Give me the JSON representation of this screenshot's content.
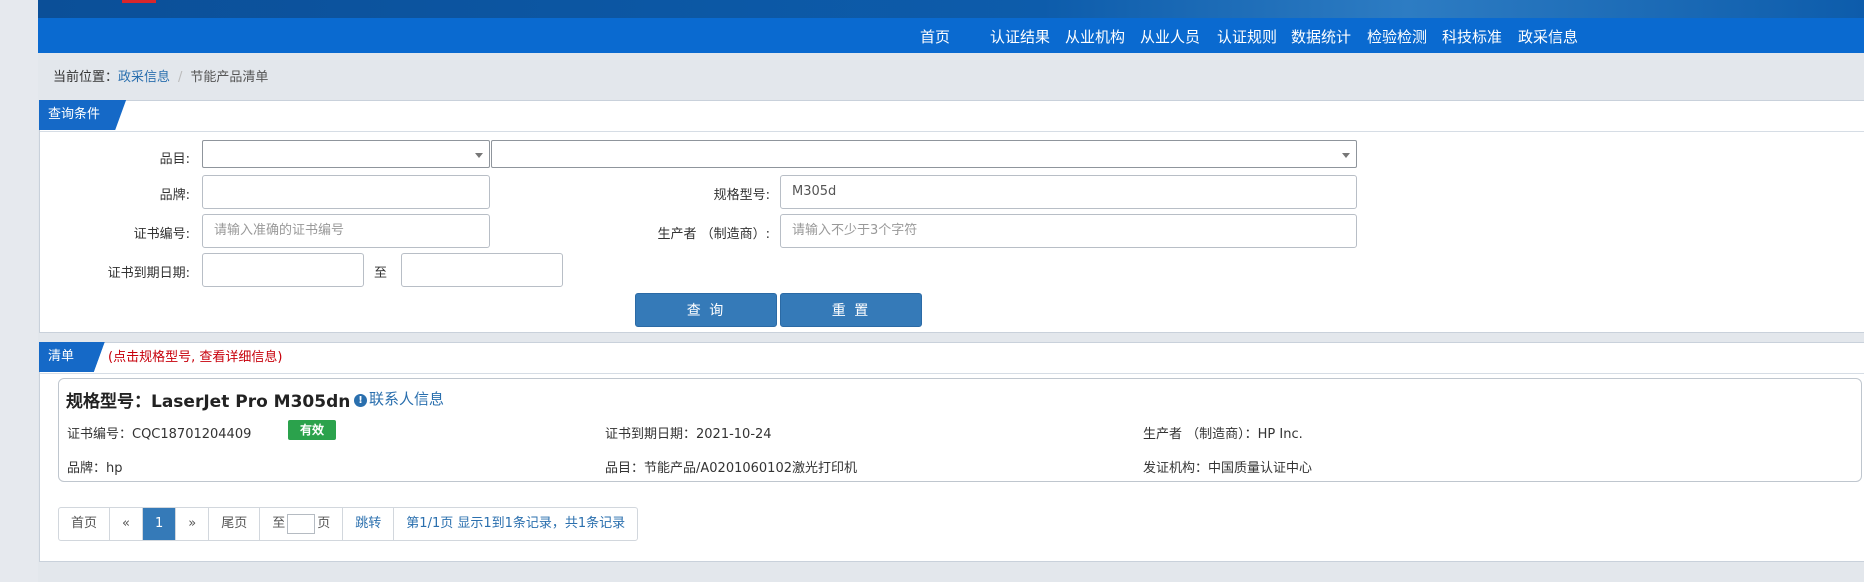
{
  "nav": {
    "items": [
      "首页",
      "认证结果",
      "从业机构",
      "从业人员",
      "认证规则",
      "数据统计",
      "检验检测",
      "科技标准",
      "政采信息"
    ]
  },
  "breadcrumb": {
    "prefix": "当前位置：",
    "parent": "政采信息",
    "current": "节能产品清单"
  },
  "query": {
    "tag": "查询条件",
    "category_label": "品目:",
    "category_value": "",
    "subcategory_value": "",
    "brand_label": "品牌:",
    "brand_value": "",
    "model_label": "规格型号:",
    "model_value": "M305d",
    "cert_no_label": "证书编号:",
    "cert_no_placeholder": "请输入准确的证书编号",
    "producer_label": "生产者 （制造商）:",
    "producer_placeholder": "请输入不少于3个字符",
    "expiry_label": "证书到期日期:",
    "date_to": "至",
    "search_button": "查 询",
    "reset_button": "重 置"
  },
  "list": {
    "tag": "清单",
    "note": "(点击规格型号, 查看详细信息)",
    "record": {
      "title": "规格型号：LaserJet Pro M305dn",
      "contact_link": "联系人信息",
      "cert_no": "证书编号：CQC18701204409",
      "status": "有效",
      "expiry": "证书到期日期：2021-10-24",
      "producer": "生产者 （制造商）：HP Inc.",
      "brand": "品牌：hp",
      "category": "品目：节能产品/A0201060102激光打印机",
      "issuer": "发证机构：中国质量认证中心"
    }
  },
  "pager": {
    "first": "首页",
    "prev": "«",
    "page": "1",
    "next": "»",
    "last": "尾页",
    "goto_prefix": "至",
    "goto_suffix": "页",
    "jump": "跳转",
    "summary": "第1/1页  显示1到1条记录，共1条记录"
  },
  "colors": {
    "nav_blue": "#0a6ad0",
    "button_blue": "#357ab8",
    "status_green": "#2ba24c",
    "note_red": "#c7000b",
    "link_blue": "#2a6fae"
  }
}
